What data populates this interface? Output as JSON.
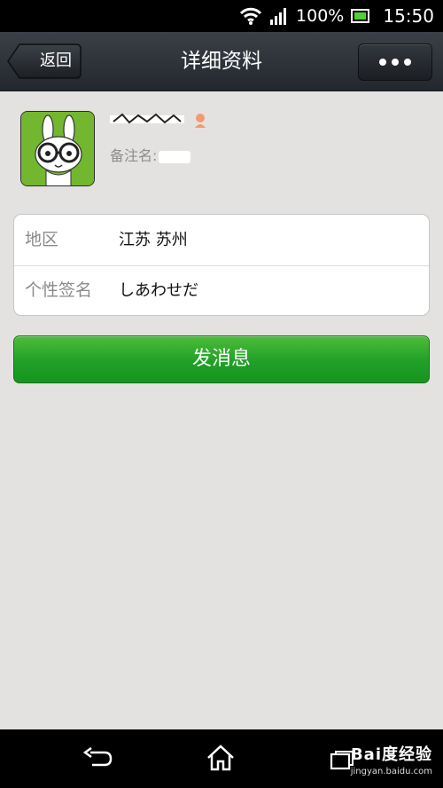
{
  "status_bar": {
    "battery_percent": "100%",
    "time": "15:50",
    "icons": [
      "wifi-icon",
      "signal-icon",
      "battery-icon"
    ]
  },
  "header": {
    "back_label": "返回",
    "title": "详细资料",
    "more_icon": "more-dots-icon"
  },
  "profile": {
    "remark_label": "备注名:"
  },
  "info": {
    "rows": [
      {
        "key": "地区",
        "value": "江苏  苏州"
      },
      {
        "key": "个性签名",
        "value": "しあわせだ"
      }
    ]
  },
  "actions": {
    "send_message": "发消息"
  },
  "watermark": {
    "main": "Bai度经验",
    "sub": "jingyan.baidu.com"
  },
  "colors": {
    "accent_green": "#20a027",
    "header_dark": "#2b2f35",
    "background": "#e3e2e0"
  }
}
